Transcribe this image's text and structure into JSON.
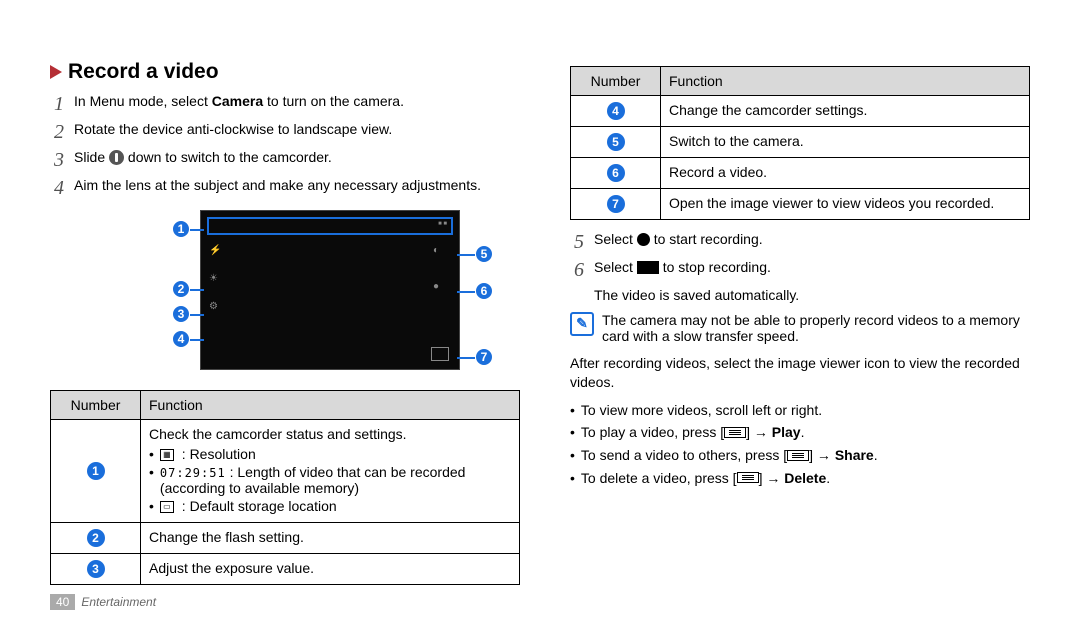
{
  "heading": "Record a video",
  "steps_left": {
    "s1_pre": "In Menu mode, select ",
    "s1_bold": "Camera",
    "s1_post": " to turn on the camera.",
    "s2": "Rotate the device anti-clockwise to landscape view.",
    "s3_pre": "Slide ",
    "s3_post": " down to switch to the camcorder.",
    "s4": "Aim the lens at the subject and make any necessary adjustments."
  },
  "table_left": {
    "h_num": "Number",
    "h_fun": "Function",
    "row1_intro": "Check the camcorder status and settings.",
    "row1_b1": " : Resolution",
    "row1_b2_pre": " : Length of video that can be recorded (according to available memory)",
    "row1_b2_digits": "07:29:51",
    "row1_b3": " : Default storage location",
    "row2": "Change the flash setting.",
    "row3": "Adjust the exposure value."
  },
  "table_right": {
    "h_num": "Number",
    "h_fun": "Function",
    "r4": "Change the camcorder settings.",
    "r5": "Switch to the camera.",
    "r6": "Record a video.",
    "r7": "Open the image viewer to view videos you recorded."
  },
  "steps_right": {
    "s5_pre": "Select ",
    "s5_post": " to start recording.",
    "s6_pre": "Select ",
    "s6_post": " to stop recording.",
    "s6_note": "The video is saved automatically."
  },
  "note": "The camera may not be able to properly record videos to a memory card with a slow transfer speed.",
  "after_para": "After recording videos, select the image viewer icon to view the recorded videos.",
  "bullets": {
    "b1": "To view more videos, scroll left or right.",
    "b2_pre": "To play a video, press [",
    "b2_mid": "] → ",
    "b2_bold": "Play",
    "b3_pre": "To send a video to others, press [",
    "b3_mid": "] → ",
    "b3_bold": "Share",
    "b4_pre": "To delete a video, press [",
    "b4_mid": "] → ",
    "b4_bold": "Delete"
  },
  "nums": {
    "n1": "1",
    "n2": "2",
    "n3": "3",
    "n4": "4",
    "n5": "5",
    "n6": "6",
    "n7": "7"
  },
  "callouts": {
    "c1": "1",
    "c2": "2",
    "c3": "3",
    "c4": "4",
    "c5": "5",
    "c6": "6",
    "c7": "7"
  },
  "footer": {
    "page": "40",
    "section": "Entertainment"
  },
  "dot": "•",
  "period": "."
}
